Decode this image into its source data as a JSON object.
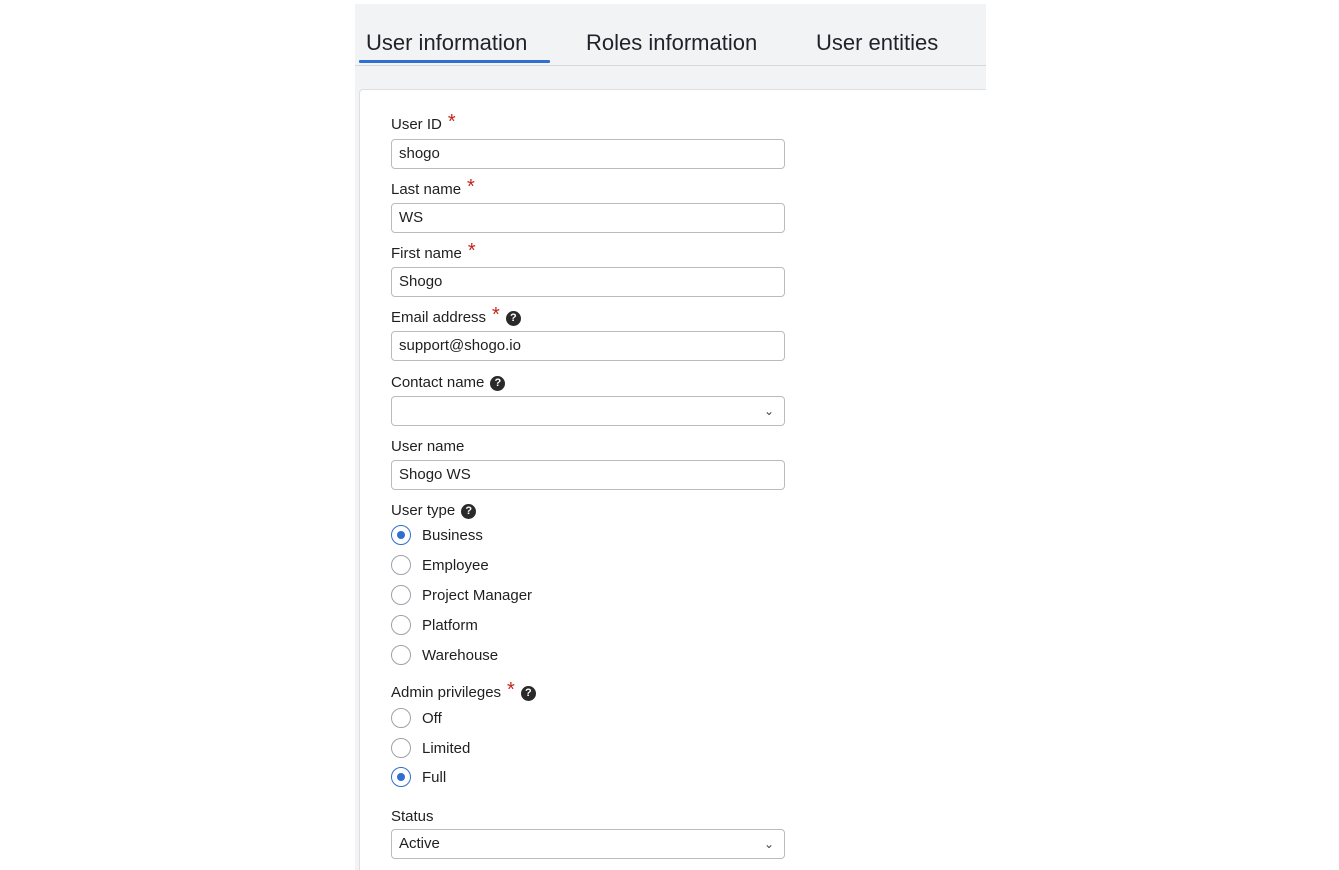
{
  "tabs": [
    {
      "label": "User information"
    },
    {
      "label": "Roles information"
    },
    {
      "label": "User entities"
    }
  ],
  "form": {
    "user_id": {
      "label": "User ID",
      "value": "shogo"
    },
    "last_name": {
      "label": "Last name",
      "value": "WS"
    },
    "first_name": {
      "label": "First name",
      "value": "Shogo"
    },
    "email": {
      "label": "Email address",
      "value": "support@shogo.io"
    },
    "contact_name": {
      "label": "Contact name",
      "value": ""
    },
    "user_name": {
      "label": "User name",
      "value": "Shogo WS"
    },
    "user_type": {
      "label": "User type",
      "options": [
        "Business",
        "Employee",
        "Project Manager",
        "Platform",
        "Warehouse"
      ],
      "selected": "Business"
    },
    "admin_privileges": {
      "label": "Admin privileges",
      "options": [
        "Off",
        "Limited",
        "Full"
      ],
      "selected": "Full"
    },
    "status": {
      "label": "Status",
      "value": "Active"
    },
    "required_marker": "*",
    "help_glyph": "?"
  },
  "icons": {
    "help": "question-circle-icon",
    "dropdown": "chevron-down-icon"
  },
  "colors": {
    "accent": "#2f6fd1",
    "required": "#c3221b",
    "panel_bg": "#f2f3f5"
  }
}
